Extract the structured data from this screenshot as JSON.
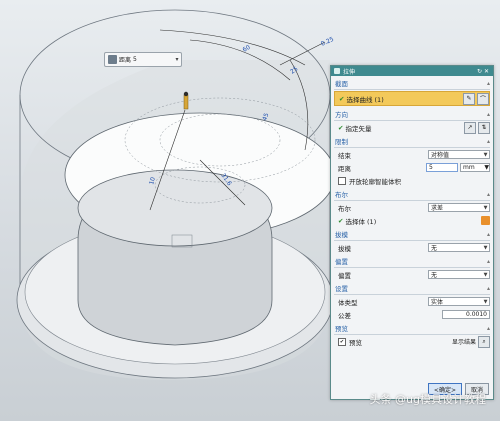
{
  "floating_box": {
    "label": "距离",
    "value": "5"
  },
  "dimensions": [
    {
      "text": "0.25"
    },
    {
      "text": "60"
    },
    {
      "text": "25"
    },
    {
      "text": "45"
    },
    {
      "text": "31.6"
    },
    {
      "text": "10"
    }
  ],
  "dialog": {
    "title": "拉伸",
    "sections": {
      "section": {
        "header": "截面",
        "select_curve": "选择曲线 (1)"
      },
      "direction": {
        "header": "方向",
        "specify_vector": "指定矢量"
      },
      "limits": {
        "header": "限制",
        "end_label": "结束",
        "end_value": "对称值",
        "distance_label": "距离",
        "distance_value": "5",
        "distance_unit": "mm",
        "open_profile_label": "开放轮廓智能体积"
      },
      "boolean": {
        "header": "布尔",
        "boolean_label": "布尔",
        "boolean_value": "求差",
        "select_body": "选择体 (1)"
      },
      "draft": {
        "header": "拔模",
        "label": "拔模",
        "value": "无"
      },
      "offset": {
        "header": "偏置",
        "label": "偏置",
        "value": "无"
      },
      "settings": {
        "header": "设置",
        "body_type_label": "体类型",
        "body_type_value": "实体",
        "tolerance_label": "公差",
        "tolerance_value": "0.0010"
      },
      "preview": {
        "header": "预览",
        "preview_label": "预览",
        "show_result": "显示结果"
      }
    },
    "ok_label": "<确定>",
    "cancel_label": "取消"
  },
  "watermark": "头条 @ug模具设计教程"
}
